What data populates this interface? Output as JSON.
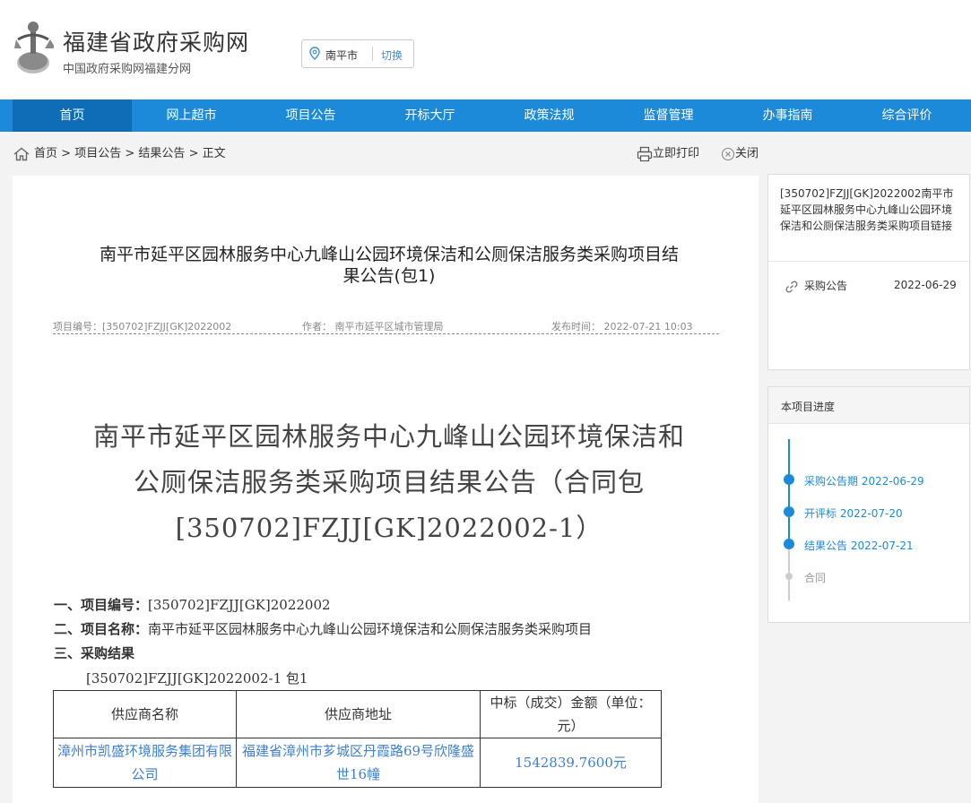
{
  "header": {
    "title": "福建省政府采购网",
    "subtitle": "中国政府采购网福建分网",
    "city": "南平市",
    "switch_label": "切换"
  },
  "nav": [
    "首页",
    "网上超市",
    "项目公告",
    "开标大厅",
    "政策法规",
    "监督管理",
    "办事指南",
    "综合评价"
  ],
  "breadcrumb": [
    "首页",
    "项目公告",
    "结果公告",
    "正文"
  ],
  "tools": {
    "print": "立即打印",
    "close": "关闭"
  },
  "article": {
    "title_line1": "南平市延平区园林服务中心九峰山公园环境保洁和公厕保洁服务类采购项目结",
    "title_line2": "果公告(包1)",
    "meta_project": "项目编号：[350702]FZJJ[GK]2022002",
    "meta_author": "作者：  南平市延平区城市管理局",
    "meta_time": "发布时间：  2022-07-21 10:03",
    "big_title_lines": [
      "南平市延平区园林服务中心九峰山公园环境保洁和",
      "公厕保洁服务类采购项目结果公告（合同包",
      "[350702]FZJJ[GK]2022002-1）"
    ],
    "line1_label": "一、项目编号：",
    "line1_value": "[350702]FZJJ[GK]2022002",
    "line2_label": "二、项目名称：",
    "line2_value": "南平市延平区园林服务中心九峰山公园环境保洁和公厕保洁服务类采购项目",
    "line3_label": "三、采购结果",
    "package_line": "[350702]FZJJ[GK]2022002-1 包1",
    "table": {
      "headers": [
        "供应商名称",
        "供应商地址",
        "中标（成交）金额（单位：元）"
      ],
      "row": [
        "漳州市凯盛环境服务集团有限公司",
        "福建省漳州市芗城区丹霞路69号欣隆盛世16幢",
        "1542839.7600元"
      ]
    }
  },
  "sidebar": {
    "project_title": "[350702]FZJJ[GK]2022002南平市延平区园林服务中心九峰山公园环境保洁和公厕保洁服务类采购项目链接",
    "link_item": "采购公告",
    "link_date": "2022-06-29",
    "progress_header": "本项目进度",
    "steps": [
      {
        "label": "采购公告期",
        "date": "2022-06-29"
      },
      {
        "label": "开评标",
        "date": "2022-07-20"
      },
      {
        "label": "结果公告",
        "date": "2022-07-21"
      },
      {
        "label": "合同",
        "date": ""
      }
    ]
  },
  "colors": {
    "nav": "#1c8ad8",
    "nav_active": "#0f6db8",
    "link": "#3d7fd0"
  }
}
